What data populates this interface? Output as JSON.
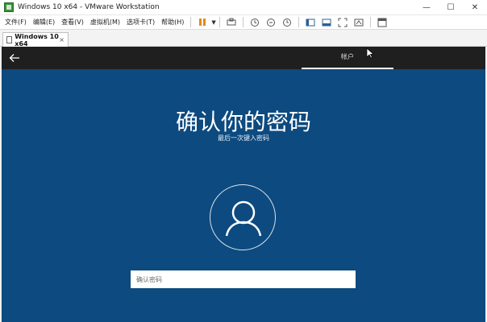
{
  "window": {
    "title": "Windows 10 x64 - VMware Workstation",
    "controls": {
      "minimize": "—",
      "maximize": "☐",
      "close": "✕"
    }
  },
  "menu": {
    "items": [
      "文件(F)",
      "编辑(E)",
      "查看(V)",
      "虚拟机(M)",
      "选项卡(T)",
      "帮助(H)"
    ]
  },
  "tabs": {
    "vm_tab": {
      "label": "Windows 10 x64",
      "close": "×"
    }
  },
  "guest": {
    "top_tab": "帐户",
    "heading": "确认你的密码",
    "subheading": "最后一次键入密码",
    "password_placeholder": "确认密码"
  },
  "colors": {
    "guest_background": "#0d4a7f",
    "guest_topbar": "#1f1f1f",
    "pause_accent": "#e08a1f"
  }
}
